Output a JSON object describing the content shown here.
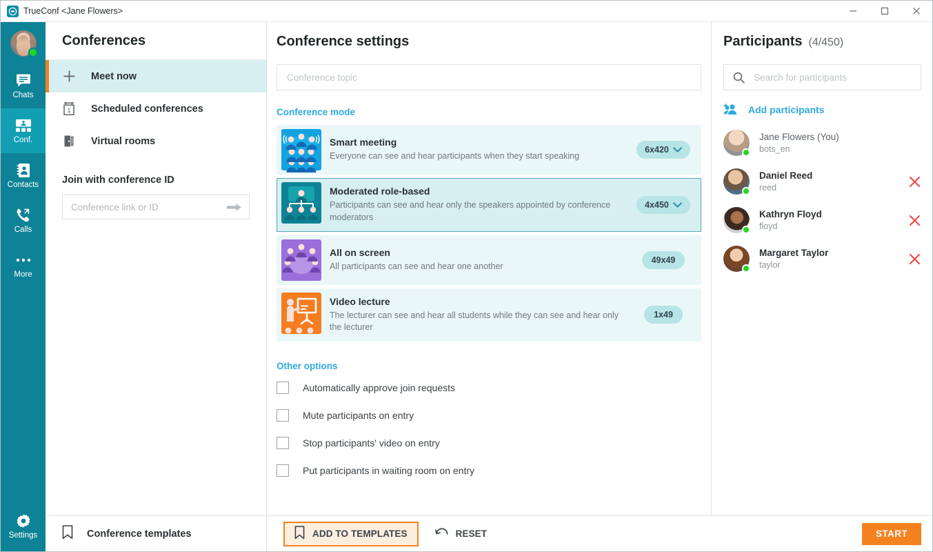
{
  "window": {
    "app_name": "TrueConf",
    "title": "TrueConf <Jane Flowers>",
    "logo_icon": "trueconf-logo-icon",
    "minimize_icon": "minimize-icon",
    "maximize_icon": "maximize-icon",
    "close_icon": "close-icon"
  },
  "rail": {
    "avatar_icon": "user-avatar",
    "items": [
      {
        "label": "Chats",
        "icon": "chat-icon",
        "active": false
      },
      {
        "label": "Conf.",
        "icon": "conference-icon",
        "active": true
      },
      {
        "label": "Contacts",
        "icon": "contacts-icon",
        "active": false
      },
      {
        "label": "Calls",
        "icon": "calls-icon",
        "active": false
      },
      {
        "label": "More",
        "icon": "more-icon",
        "active": false
      }
    ],
    "settings": {
      "label": "Settings",
      "icon": "gear-icon"
    }
  },
  "conferences": {
    "title": "Conferences",
    "nav": [
      {
        "label": "Meet now",
        "icon": "plus-icon",
        "active": true
      },
      {
        "label": "Scheduled conferences",
        "icon": "calendar-icon",
        "active": false
      },
      {
        "label": "Virtual rooms",
        "icon": "door-icon",
        "active": false
      }
    ],
    "join_title": "Join with conference ID",
    "join_placeholder": "Conference link or ID",
    "join_value": "",
    "join_arrow_icon": "arrow-right-icon",
    "templates_label": "Conference templates",
    "templates_icon": "bookmark-icon"
  },
  "settings_panel": {
    "title": "Conference settings",
    "topic_placeholder": "Conference topic",
    "topic_value": "",
    "mode_section_title": "Conference mode",
    "modes": [
      {
        "name": "Smart meeting",
        "description": "Everyone can see and hear participants when they start speaking",
        "badge": "6x420",
        "has_dropdown": true,
        "selected": false,
        "icon": "smart-meeting-icon",
        "icon_color": "#13a3e0"
      },
      {
        "name": "Moderated role-based",
        "description": "Participants can see and hear only the speakers appointed by conference moderators",
        "badge": "4x450",
        "has_dropdown": true,
        "selected": true,
        "icon": "moderated-role-based-icon",
        "icon_color": "#0e8296"
      },
      {
        "name": "All on screen",
        "description": "All participants can see and hear one another",
        "badge": "49x49",
        "has_dropdown": false,
        "selected": false,
        "icon": "all-on-screen-icon",
        "icon_color": "#9b6edb"
      },
      {
        "name": "Video lecture",
        "description": "The lecturer can see and hear all students while they can see and hear only the lecturer",
        "badge": "1x49",
        "has_dropdown": false,
        "selected": false,
        "icon": "video-lecture-icon",
        "icon_color": "#f57c1f"
      }
    ],
    "options_section_title": "Other options",
    "options": [
      {
        "label": "Automatically approve join requests",
        "checked": false
      },
      {
        "label": "Mute participants on entry",
        "checked": false
      },
      {
        "label": "Stop participants' video on entry",
        "checked": false
      },
      {
        "label": "Put participants in waiting room on entry",
        "checked": false
      }
    ]
  },
  "participants": {
    "title": "Participants",
    "count_text": "(4/450)",
    "search_placeholder": "Search for participants",
    "search_value": "",
    "search_icon": "search-icon",
    "add_label": "Add participants",
    "add_icon": "add-participants-icon",
    "remove_icon": "remove-participant-icon",
    "list": [
      {
        "name": "Jane Flowers (You)",
        "login": "bots_en",
        "is_you": true,
        "status": "online"
      },
      {
        "name": "Daniel Reed",
        "login": "reed",
        "is_you": false,
        "status": "online"
      },
      {
        "name": "Kathryn Floyd",
        "login": "floyd",
        "is_you": false,
        "status": "online"
      },
      {
        "name": "Margaret Taylor",
        "login": "taylor",
        "is_you": false,
        "status": "online"
      }
    ]
  },
  "footer": {
    "add_to_templates_label": "ADD TO TEMPLATES",
    "add_to_templates_icon": "bookmark-icon",
    "reset_label": "RESET",
    "reset_icon": "undo-icon",
    "start_label": "START"
  },
  "colors": {
    "teal": "#0e8296",
    "teal_active": "#139fb3",
    "orange": "#f58220",
    "link_blue": "#2eaadc",
    "card_bg": "#eaf7f8",
    "card_selected_bg": "#d7eff0",
    "badge_bg": "#b7e4e6",
    "online_green": "#1fd81f",
    "remove_red": "#f04444"
  }
}
